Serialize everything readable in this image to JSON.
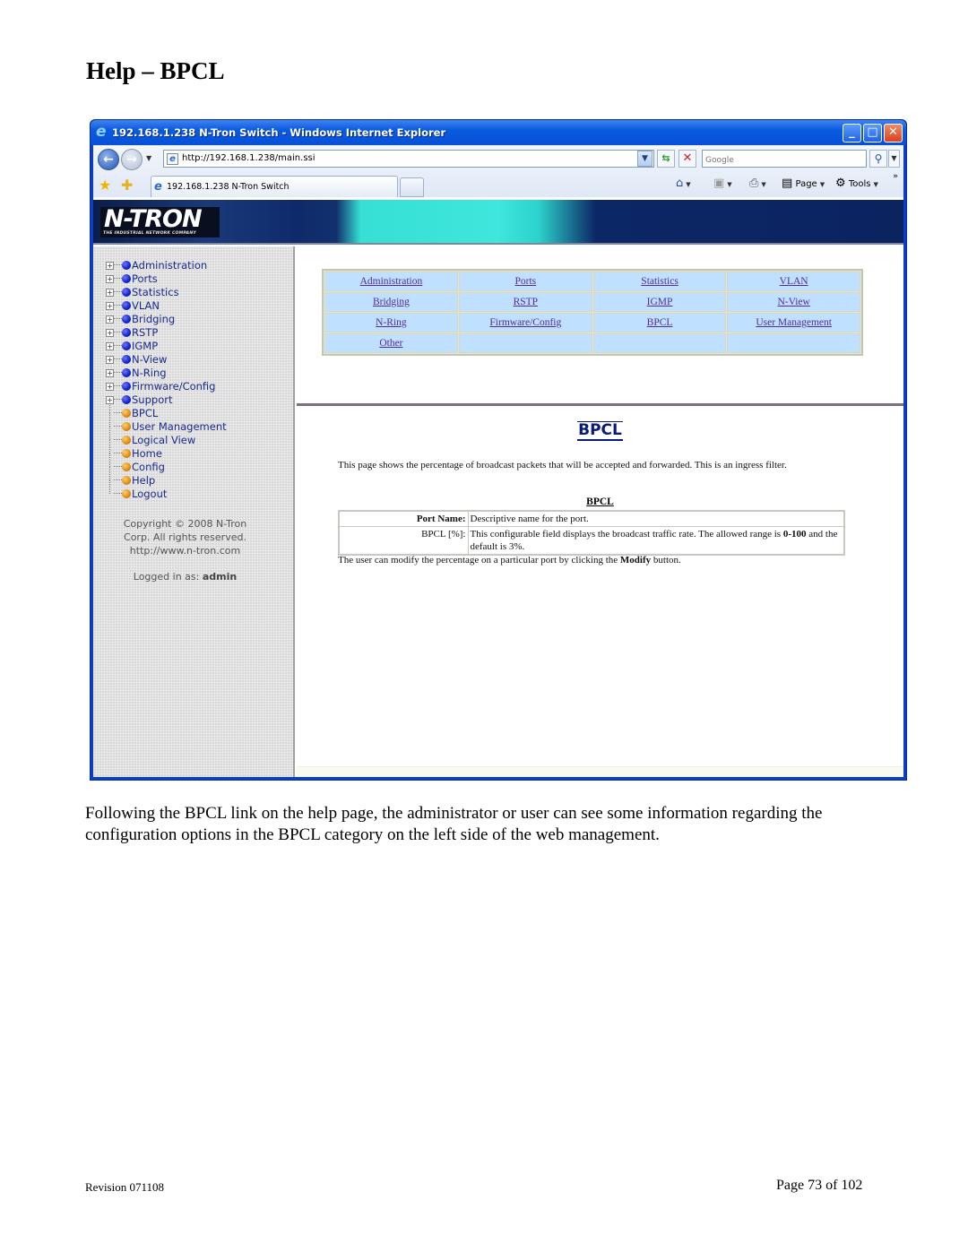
{
  "document": {
    "title": "Help – BPCL",
    "paragraph": "Following the BPCL link on the help page, the administrator or user can see some information regarding the configuration options in the BPCL category on the left side of the web management.",
    "footer": {
      "revision": "Revision 071108",
      "page": "Page 73 of 102"
    }
  },
  "browser": {
    "window_title": "192.168.1.238 N-Tron Switch - Windows Internet Explorer",
    "address": "http://192.168.1.238/main.ssi",
    "search_placeholder": "Google",
    "tab_label": "192.168.1.238 N-Tron Switch",
    "commands": {
      "page": "Page",
      "tools": "Tools"
    },
    "icons": {
      "back": "back-arrow-icon",
      "forward": "forward-arrow-icon",
      "refresh": "refresh-icon",
      "stop": "stop-icon",
      "search": "magnifier-icon",
      "favorites": "star-icon",
      "add_favorite": "add-favorite-icon",
      "home": "home-icon",
      "feeds": "rss-feed-icon",
      "print": "printer-icon",
      "page": "page-icon",
      "tools": "gear-icon"
    }
  },
  "app": {
    "logo": {
      "name": "N-TRON",
      "tagline": "THE INDUSTRIAL NETWORK COMPANY"
    },
    "sidebar": {
      "items": [
        {
          "label": "Administration",
          "type": "folder"
        },
        {
          "label": "Ports",
          "type": "folder"
        },
        {
          "label": "Statistics",
          "type": "folder"
        },
        {
          "label": "VLAN",
          "type": "folder"
        },
        {
          "label": "Bridging",
          "type": "folder"
        },
        {
          "label": "RSTP",
          "type": "folder"
        },
        {
          "label": "IGMP",
          "type": "folder"
        },
        {
          "label": "N-View",
          "type": "folder"
        },
        {
          "label": "N-Ring",
          "type": "folder"
        },
        {
          "label": "Firmware/Config",
          "type": "folder"
        },
        {
          "label": "Support",
          "type": "folder"
        },
        {
          "label": "BPCL",
          "type": "page"
        },
        {
          "label": "User Management",
          "type": "page"
        },
        {
          "label": "Logical View",
          "type": "page"
        },
        {
          "label": "Home",
          "type": "page"
        },
        {
          "label": "Config",
          "type": "page"
        },
        {
          "label": "Help",
          "type": "page"
        },
        {
          "label": "Logout",
          "type": "page"
        }
      ],
      "copyright": [
        "Copyright © 2008 N-Tron",
        "Corp. All rights reserved.",
        "http://www.n-tron.com"
      ],
      "logged_in_label": "Logged in as:",
      "logged_in_user": "admin"
    },
    "help_links": [
      [
        "Administration",
        "Ports",
        "Statistics",
        "VLAN"
      ],
      [
        "Bridging",
        "RSTP",
        "IGMP",
        "N-View"
      ],
      [
        "N-Ring",
        "Firmware/Config",
        "BPCL",
        "User Management"
      ],
      [
        "Other",
        "",
        "",
        ""
      ]
    ],
    "help": {
      "heading": "BPCL",
      "intro": "This page shows the percentage of broadcast packets that will be accepted and forwarded. This is an ingress filter.",
      "table_caption": "BPCL",
      "rows": [
        {
          "field": "Port Name:",
          "description": "Descriptive name for the port."
        },
        {
          "field": "BPCL [%]:",
          "description_pre": "This configurable field displays the broadcast traffic rate. The allowed range is ",
          "description_bold": "0-100",
          "description_post": " and the default is 3%."
        }
      ],
      "note_pre": "The user can modify the percentage on a particular port by clicking the ",
      "note_bold": "Modify",
      "note_post": " button."
    }
  },
  "colors": {
    "titlebar_blue": "#0a5ae0",
    "link_cell_bg": "#bfe0ff",
    "link_color": "#552a9a",
    "sidebar_text": "#1a2a8a",
    "heading_navy": "#0a1a7a"
  }
}
